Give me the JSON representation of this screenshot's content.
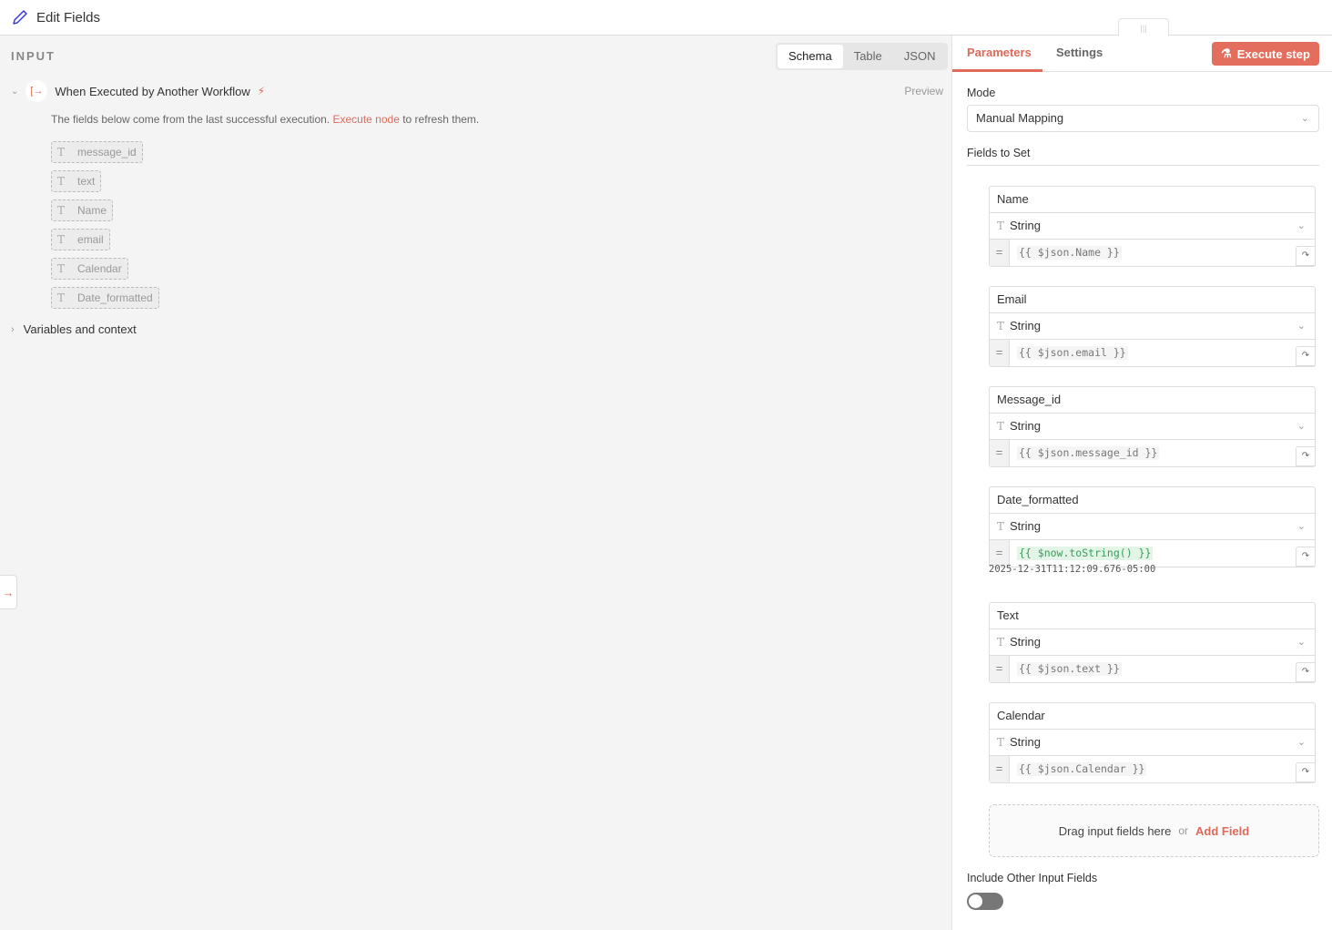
{
  "header": {
    "title": "Edit Fields"
  },
  "input": {
    "label": "INPUT",
    "views": [
      "Schema",
      "Table",
      "JSON"
    ],
    "trigger": "When Executed by Another Workflow",
    "preview": "Preview",
    "note_before": "The fields below come from the last successful execution.",
    "note_link": "Execute node",
    "note_after": "to refresh them.",
    "fields": [
      "message_id",
      "text",
      "Name",
      "email",
      "Calendar",
      "Date_formatted"
    ],
    "variables": "Variables and context"
  },
  "params": {
    "tabs": [
      "Parameters",
      "Settings"
    ],
    "execute": "Execute step",
    "mode_label": "Mode",
    "mode_value": "Manual Mapping",
    "fields_label": "Fields to Set",
    "fields": [
      {
        "name": "Name",
        "type": "String",
        "value": "{{ $json.Name }}"
      },
      {
        "name": "Email",
        "type": "String",
        "value": "{{ $json.email }}"
      },
      {
        "name": "Message_id",
        "type": "String",
        "value": "{{ $json.message_id }}"
      },
      {
        "name": "Date_formatted",
        "type": "String",
        "value": "{{ $now.toString() }}",
        "hint": "2025-12-31T11:12:09.676-05:00"
      },
      {
        "name": "Text",
        "type": "String",
        "value": "{{ $json.text }}"
      },
      {
        "name": "Calendar",
        "type": "String",
        "value": "{{ $json.Calendar }}"
      }
    ],
    "drop_text": "Drag input fields here",
    "drop_or": "or",
    "add_field": "Add Field",
    "include_label": "Include Other Input Fields",
    "include_on": false
  }
}
